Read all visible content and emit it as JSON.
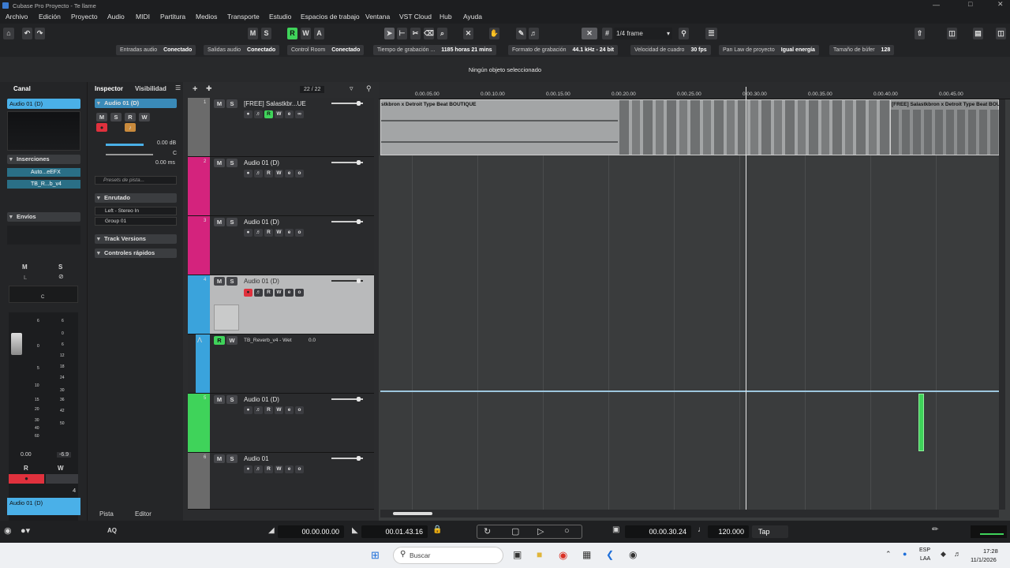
{
  "window": {
    "title": "Cubase Pro Proyecto - Te llame"
  },
  "menu": [
    "Archivo",
    "Edición",
    "Proyecto",
    "Audio",
    "MIDI",
    "Partitura",
    "Medios",
    "Transporte",
    "Estudio",
    "Espacios de trabajo",
    "Ventana",
    "VST Cloud",
    "Hub",
    "Ayuda"
  ],
  "toolbar": {
    "m": "M",
    "s": "S",
    "r": "R",
    "w": "W",
    "a": "A",
    "quantize": "1/4 frame"
  },
  "status": [
    {
      "label": "Entradas audio",
      "value": "Conectado"
    },
    {
      "label": "Salidas audio",
      "value": "Conectado"
    },
    {
      "label": "Control Room",
      "value": "Conectado"
    },
    {
      "label": "Tiempo de grabación ...",
      "value": "1185 horas 21 mins"
    },
    {
      "label": "Formato de grabación",
      "value": "44.1 kHz - 24 bit"
    },
    {
      "label": "Velocidad de cuadro",
      "value": "30 fps"
    },
    {
      "label": "Pan Law de proyecto",
      "value": "Igual energía"
    },
    {
      "label": "Tamaño de búfer",
      "value": "128"
    }
  ],
  "info": "Ningún objeto seleccionado",
  "left": {
    "tab": "Canal",
    "channel": "Audio 01 (D)",
    "inserts_label": "Inserciones",
    "inserts": [
      "Auto...eEFX",
      "TB_R...b_v4"
    ],
    "sends_label": "Envíos",
    "m": "M",
    "s": "S",
    "l": "L",
    "pan": "C",
    "vol": "0.00",
    "peak": "-6.9",
    "r": "R",
    "w": "W",
    "num": "4",
    "bottom_name": "Audio 01 (D)",
    "scale": [
      "6",
      "0",
      "5",
      "10",
      "15",
      "20",
      "30",
      "40",
      "60"
    ],
    "scale2": [
      "6",
      "0",
      "6",
      "12",
      "18",
      "24",
      "30",
      "36",
      "42",
      "50"
    ]
  },
  "inspector": {
    "tab1": "Inspector",
    "tab2": "Visibilidad",
    "count": "22 / 22",
    "track": "Audio 01 (D)",
    "vol": "0.00 dB",
    "pan": "C",
    "delay": "0.00 ms",
    "presets": "Presets de pista...",
    "routing": "Enrutado",
    "route_in": "Left - Stereo In",
    "route_out": "Group 01",
    "versions": "Track Versions",
    "quick": "Controles rápidos",
    "bottom1": "Pista",
    "bottom2": "Editor"
  },
  "tracks": [
    {
      "n": "1",
      "name": "[FREE] Salastkbr...UE",
      "color": "#6b6b6b"
    },
    {
      "n": "2",
      "name": "Audio 01 (D)",
      "color": "#d4237d"
    },
    {
      "n": "3",
      "name": "Audio 01 (D)",
      "color": "#d4237d"
    },
    {
      "n": "4",
      "name": "Audio 01 (D)",
      "color": "#3aa3dc"
    },
    {
      "n": "5",
      "name": "Audio 01 (D)",
      "color": "#3fd35a"
    },
    {
      "n": "6",
      "name": "Audio 01",
      "color": "#6b6b6b"
    }
  ],
  "automation": {
    "param": "TB_Reverb_v4 - Wet",
    "value": "0.0"
  },
  "ruler": [
    "0.00.05.00",
    "0.00.10.00",
    "0.00.15.00",
    "0.00.20.00",
    "0.00.25.00",
    "0.00.30.00",
    "0.00.35.00",
    "0.00.40.00",
    "0.00.45.00"
  ],
  "clips": {
    "a": "stkbron x Detroit Type Beat  BOUTIQUE",
    "b": "[FREE] Salastkbron x Detroit Type Beat  BOUTIQ"
  },
  "transport": {
    "left": "00.00.00.00",
    "right": "00.01.43.16",
    "pos": "00.00.30.24",
    "tempo": "120.000",
    "tap": "Tap",
    "aq": "AQ"
  },
  "taskbar": {
    "search": "Buscar",
    "lang1": "ESP",
    "lang2": "LAA",
    "time": "17:28",
    "date": "11/1/2026"
  },
  "colors": {
    "accent_green": "#3fd35a",
    "accent_red": "#e0313d",
    "accent_blue": "#4ab0e8"
  }
}
